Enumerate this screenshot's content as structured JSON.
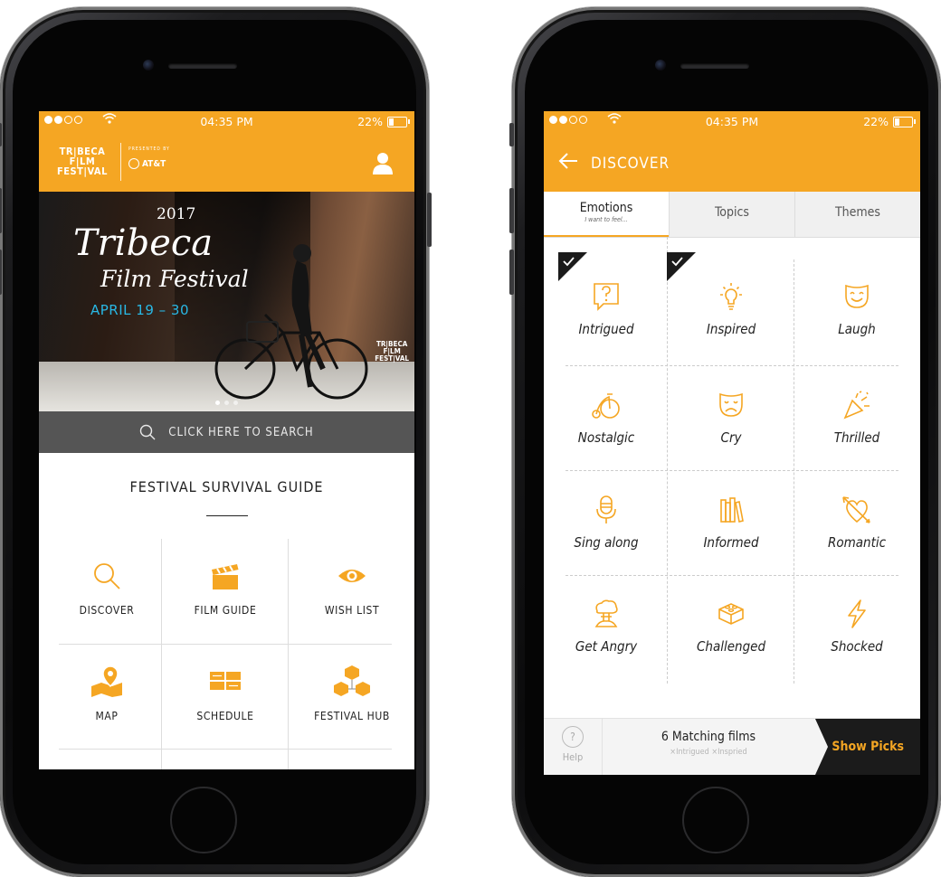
{
  "status_bar": {
    "time": "04:35 PM",
    "battery": "22%"
  },
  "left_screen": {
    "logo": {
      "line1": "TR|BECA",
      "line2": "F|LM",
      "line3": "FEST|VAL",
      "presented": "PRESENTED BY",
      "sponsor": "AT&T"
    },
    "hero": {
      "year": "2017",
      "title": "Tribeca",
      "subtitle": "Film Festival",
      "dates": "APRIL 19 – 30"
    },
    "search_placeholder": "CLICK HERE TO SEARCH",
    "guide_title": "FESTIVAL SURVIVAL GUIDE",
    "menu": [
      {
        "label": "DISCOVER",
        "icon": "magnifier-icon"
      },
      {
        "label": "FILM GUIDE",
        "icon": "clapperboard-icon"
      },
      {
        "label": "WISH LIST",
        "icon": "eye-icon"
      },
      {
        "label": "MAP",
        "icon": "map-pin-icon"
      },
      {
        "label": "SCHEDULE",
        "icon": "schedule-blocks-icon"
      },
      {
        "label": "FESTIVAL HUB",
        "icon": "cubes-icon"
      }
    ]
  },
  "right_screen": {
    "title": "DISCOVER",
    "tabs": [
      {
        "label": "Emotions",
        "sub": "I want to feel..."
      },
      {
        "label": "Topics"
      },
      {
        "label": "Themes"
      }
    ],
    "emotions": [
      {
        "label": "Intrigued",
        "icon": "question-bubble-icon",
        "selected": true
      },
      {
        "label": "Inspired",
        "icon": "lightbulb-icon",
        "selected": true
      },
      {
        "label": "Laugh",
        "icon": "happy-mask-icon",
        "selected": false
      },
      {
        "label": "Nostalgic",
        "icon": "penny-farthing-icon",
        "selected": false
      },
      {
        "label": "Cry",
        "icon": "sad-mask-icon",
        "selected": false
      },
      {
        "label": "Thrilled",
        "icon": "party-popper-icon",
        "selected": false
      },
      {
        "label": "Sing along",
        "icon": "microphone-icon",
        "selected": false
      },
      {
        "label": "Informed",
        "icon": "books-icon",
        "selected": false
      },
      {
        "label": "Romantic",
        "icon": "heart-arrow-icon",
        "selected": false
      },
      {
        "label": "Get Angry",
        "icon": "mushroom-cloud-icon",
        "selected": false
      },
      {
        "label": "Challenged",
        "icon": "puzzle-brick-icon",
        "selected": false
      },
      {
        "label": "Shocked",
        "icon": "lightning-icon",
        "selected": false
      }
    ],
    "footer": {
      "help": "Help",
      "help_glyph": "?",
      "matching": "6 Matching films",
      "filters": "×Intrigued ×Inspried",
      "show_picks": "Show Picks"
    }
  },
  "colors": {
    "accent": "#f5a623",
    "dark": "#1b1b1b",
    "search_bar": "#555555",
    "date_blue": "#29b8e5"
  }
}
